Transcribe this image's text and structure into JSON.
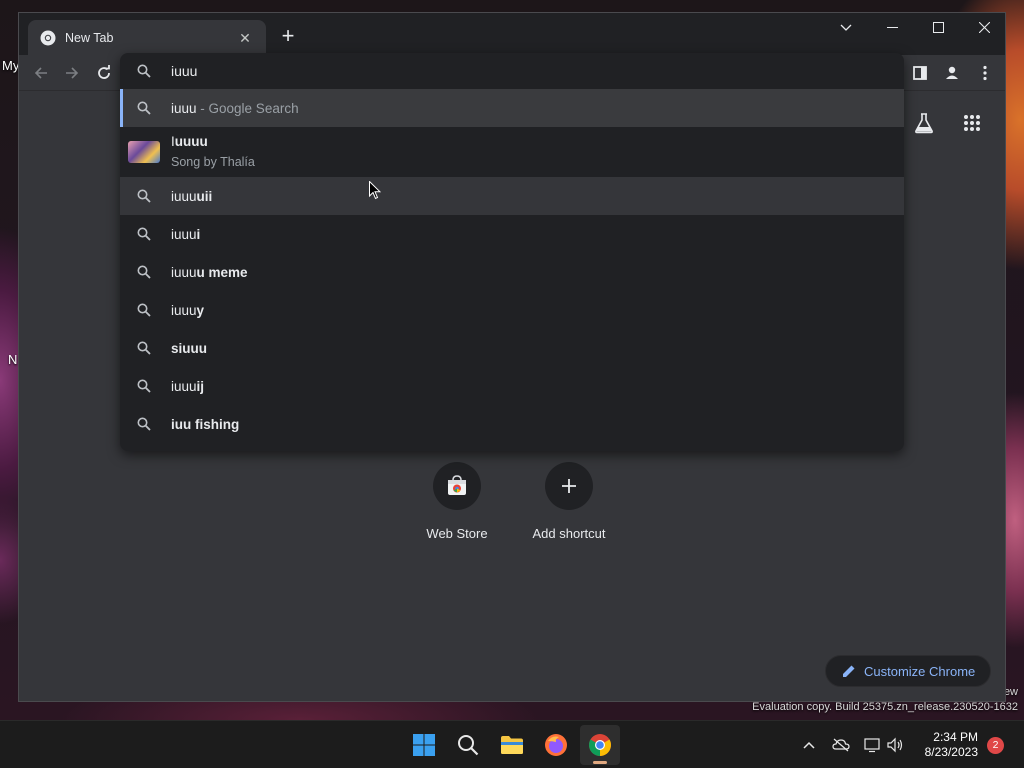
{
  "desktop": {
    "label_top": "My",
    "label_mid": "N",
    "watermark_line1": "ew",
    "watermark_line2": "Evaluation copy. Build 25375.zn_release.230520-1632"
  },
  "browser": {
    "tab_title": "New Tab",
    "omnibox_value": "iuuu",
    "suggestions": [
      {
        "type": "search",
        "plain": "iuuu",
        "bold": "",
        "suffix": " - Google Search"
      },
      {
        "type": "entity",
        "plain": "I",
        "bold": "uuuu",
        "subtitle": "Song by Thalía"
      },
      {
        "type": "search",
        "plain": "iuuu",
        "bold": "uii"
      },
      {
        "type": "search",
        "plain": "iuuu",
        "bold": "i"
      },
      {
        "type": "search",
        "plain": "iuuu",
        "bold": "u meme"
      },
      {
        "type": "search",
        "plain": "iuuu",
        "bold": "y"
      },
      {
        "type": "search",
        "plain": "",
        "bold": "siuuu"
      },
      {
        "type": "search",
        "plain": "iuuu",
        "bold": "ij"
      },
      {
        "type": "search",
        "plain": "",
        "bold": "iuu fishing"
      }
    ],
    "shortcuts": [
      {
        "label": "Web Store"
      },
      {
        "label": "Add shortcut"
      }
    ],
    "customize_label": "Customize Chrome"
  },
  "taskbar": {
    "time": "2:34 PM",
    "date": "8/23/2023",
    "notification_count": "2"
  },
  "colors": {
    "accent": "#8ab4f8",
    "window_bg": "#35363a",
    "dropdown_bg": "#202124"
  }
}
